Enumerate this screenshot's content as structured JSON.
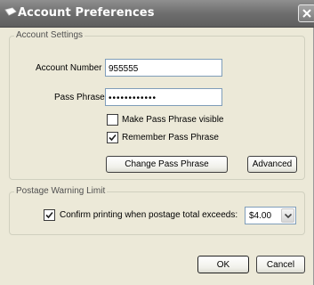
{
  "window": {
    "title": "Account Preferences",
    "title_icon": "envelope-icon",
    "close_icon": "close-icon"
  },
  "account_settings": {
    "legend": "Account Settings",
    "account_number_label": "Account Number",
    "account_number_value": "955555",
    "pass_phrase_label": "Pass Phrase",
    "pass_phrase_value": "••••••••••••",
    "make_visible_label": "Make Pass Phrase visible",
    "make_visible_checked": false,
    "remember_label": "Remember Pass Phrase",
    "remember_checked": true,
    "change_button": "Change Pass Phrase",
    "advanced_button": "Advanced"
  },
  "postage_warning": {
    "legend": "Postage Warning Limit",
    "confirm_label": "Confirm printing when postage total exceeds:",
    "confirm_checked": true,
    "limit_value": "$4.00"
  },
  "footer": {
    "ok_button": "OK",
    "cancel_button": "Cancel"
  }
}
